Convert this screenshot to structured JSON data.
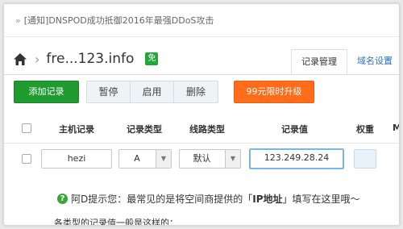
{
  "notice": {
    "text": "[通知]DNSPOD成功抵御2016年最强DDoS攻击"
  },
  "breadcrumb": {
    "domain": "fre...123.info",
    "free_badge": "免"
  },
  "tabs": [
    {
      "label": "记录管理",
      "active": true
    },
    {
      "label": "域名设置",
      "active": false
    }
  ],
  "toolbar": {
    "add_label": "添加记录",
    "pause_label": "暂停",
    "enable_label": "启用",
    "delete_label": "删除",
    "upgrade_label": "99元限时升级"
  },
  "table": {
    "headers": {
      "host": "主机记录",
      "type": "记录类型",
      "line": "线路类型",
      "value": "记录值",
      "weight": "权重",
      "mx": "M"
    }
  },
  "row": {
    "host": "hezi",
    "type": "A",
    "line": "默认",
    "value": "123.249.28.24",
    "weight": ""
  },
  "tip": {
    "prefix": "阿D提示您：最常见的是将空间商提供的「",
    "highlight": "IP地址",
    "suffix": "」填写在这里哦～",
    "subtext": "各类型的记录值一般是这样的："
  },
  "colors": {
    "add_button": "#1f9b2f",
    "upgrade_button": "#ff6c1a",
    "link": "#2a6ebf"
  }
}
